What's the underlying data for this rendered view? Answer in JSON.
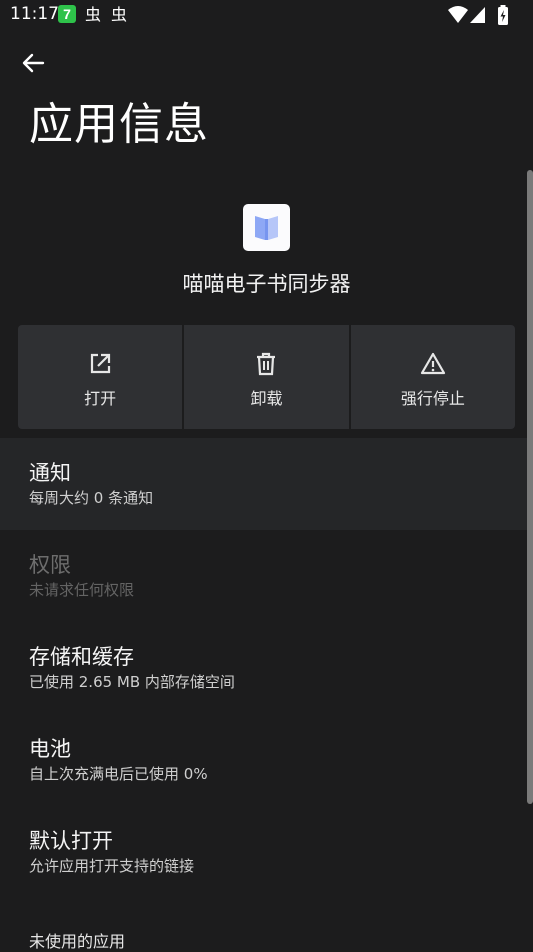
{
  "status_bar": {
    "time": "11:17",
    "notification_icons": [
      "app-notification-icon",
      "bug-icon",
      "bug-icon"
    ],
    "app_badge": "7",
    "bug_glyph": "虫",
    "right_icons": [
      "wifi-icon",
      "cell-signal-icon",
      "battery-charging-icon"
    ]
  },
  "header": {
    "back_icon": "arrow-back-icon",
    "title": "应用信息"
  },
  "app": {
    "name": "喵喵电子书同步器",
    "icon": "book-icon"
  },
  "actions": [
    {
      "label": "打开",
      "icon": "open-external-icon"
    },
    {
      "label": "卸载",
      "icon": "trash-icon"
    },
    {
      "label": "强行停止",
      "icon": "warning-icon"
    }
  ],
  "settings": [
    {
      "title": "通知",
      "subtitle": "每周大约 0 条通知"
    },
    {
      "title": "权限",
      "subtitle": "未请求任何权限"
    },
    {
      "title": "存储和缓存",
      "subtitle": "已使用 2.65 MB 内部存储空间"
    },
    {
      "title": "电池",
      "subtitle": "自上次充满电后已使用 0%"
    },
    {
      "title": "默认打开",
      "subtitle": "允许应用打开支持的链接"
    }
  ],
  "partial_section_title": "未使用的应用",
  "colors": {
    "background": "#1c1c1d",
    "action_button": "#2f3033",
    "highlight_row": "#252628",
    "app_badge": "#2ec24a",
    "book_icon": "#8ea8f5"
  }
}
